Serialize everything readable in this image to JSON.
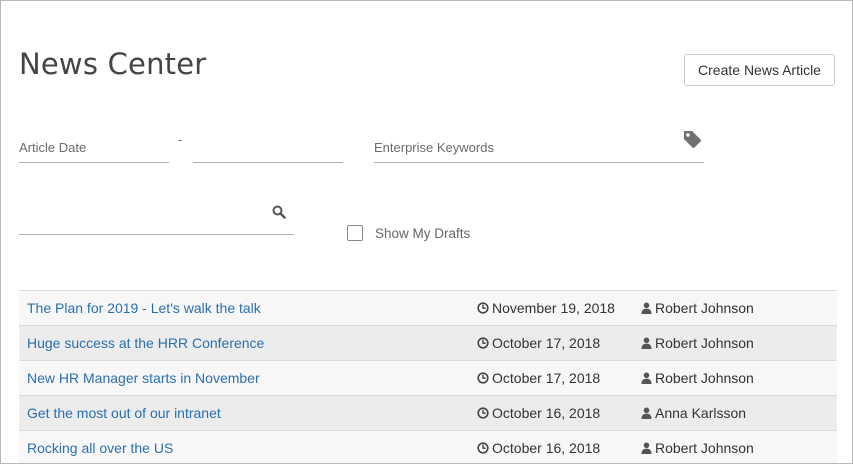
{
  "header": {
    "title": "News Center",
    "create_label": "Create News Article"
  },
  "filters": {
    "date_from_placeholder": "Article Date",
    "date_separator": "-",
    "date_to_placeholder": "",
    "keywords_placeholder": "Enterprise Keywords",
    "search_value": "",
    "show_drafts_label": "Show My Drafts",
    "show_drafts_checked": false
  },
  "icons": {
    "tag": "tag-icon",
    "search": "search-icon",
    "clock": "clock-icon",
    "user": "user-icon"
  },
  "colors": {
    "link": "#2a6fb0",
    "row_odd": "#f7f7f7",
    "row_even": "#ececec"
  },
  "articles": [
    {
      "title": "The Plan for 2019 - Let's walk the talk",
      "date": "November 19, 2018",
      "author": "Robert Johnson"
    },
    {
      "title": "Huge success at the HRR Conference",
      "date": "October 17, 2018",
      "author": "Robert Johnson"
    },
    {
      "title": "New HR Manager starts in November",
      "date": "October 17, 2018",
      "author": "Robert Johnson"
    },
    {
      "title": "Get the most out of our intranet",
      "date": "October 16, 2018",
      "author": "Anna Karlsson"
    },
    {
      "title": "Rocking all over the US",
      "date": "October 16, 2018",
      "author": "Robert Johnson"
    }
  ]
}
